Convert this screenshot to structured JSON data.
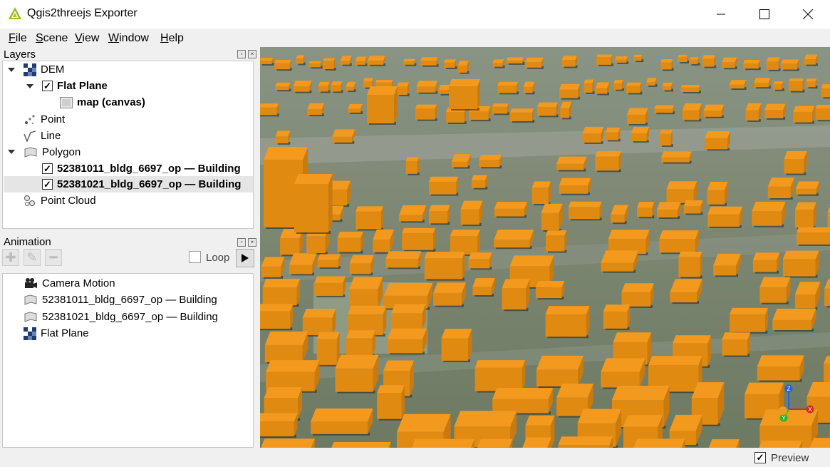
{
  "window": {
    "title": "Qgis2threejs Exporter"
  },
  "menu": [
    "File",
    "Scene",
    "View",
    "Window",
    "Help"
  ],
  "layers_panel": {
    "title": "Layers",
    "items": [
      {
        "label": "DEM",
        "icon": "dem-icon",
        "expanded": true
      },
      {
        "label": "Flat Plane",
        "checked": true,
        "bold": true,
        "expanded": true
      },
      {
        "label": "map (canvas)",
        "icon": "map-canvas-icon",
        "bold": true
      },
      {
        "label": "Point",
        "icon": "point-icon"
      },
      {
        "label": "Line",
        "icon": "line-icon"
      },
      {
        "label": "Polygon",
        "icon": "polygon-icon",
        "expanded": true
      },
      {
        "label": "52381011_bldg_6697_op — Building",
        "checked": true,
        "bold": true
      },
      {
        "label": "52381021_bldg_6697_op — Building",
        "checked": true,
        "bold": true,
        "selected": true
      },
      {
        "label": "Point Cloud",
        "icon": "point-cloud-icon"
      }
    ]
  },
  "animation_panel": {
    "title": "Animation",
    "loop_label": "Loop",
    "loop_checked": false,
    "items": [
      {
        "label": "Camera Motion",
        "icon": "camera-icon"
      },
      {
        "label": "52381011_bldg_6697_op — Building",
        "icon": "polygon-icon"
      },
      {
        "label": "52381021_bldg_6697_op — Building",
        "icon": "polygon-icon"
      },
      {
        "label": "Flat Plane",
        "icon": "dem-icon"
      }
    ]
  },
  "viewport": {
    "content": "3D buildings preview",
    "building_color": "#f39a1e",
    "ground_color": "#7f8a72"
  },
  "axes": {
    "x": "X",
    "y": "Y",
    "z": "Z"
  },
  "status": {
    "preview_label": "Preview",
    "preview_checked": true
  }
}
